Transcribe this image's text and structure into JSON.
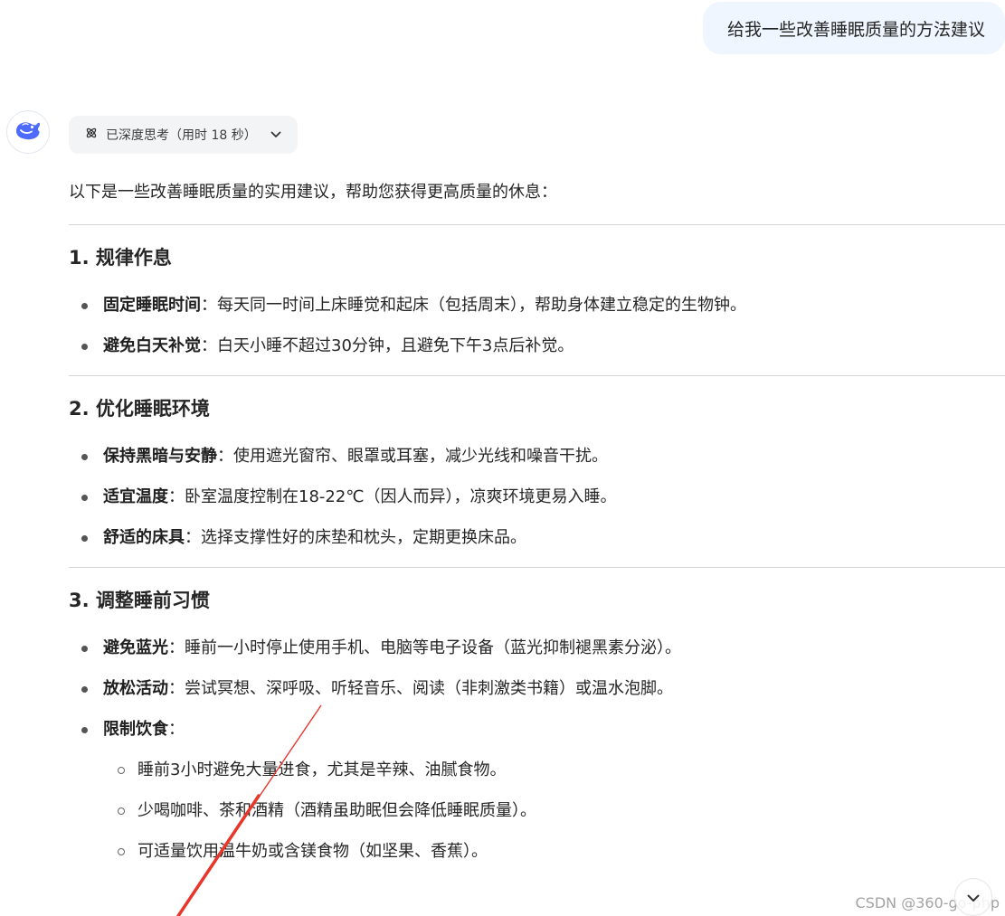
{
  "user_message": "给我一些改善睡眠质量的方法建议",
  "thinking": {
    "label": "已深度思考（用时 18 秒）"
  },
  "answer": {
    "intro": "以下是一些改善睡眠质量的实用建议，帮助您获得更高质量的休息：",
    "sections": [
      {
        "title": "1. 规律作息",
        "items": [
          {
            "bold": "固定睡眠时间",
            "text": "：每天同一时间上床睡觉和起床（包括周末），帮助身体建立稳定的生物钟。"
          },
          {
            "bold": "避免白天补觉",
            "text": "：白天小睡不超过30分钟，且避免下午3点后补觉。"
          }
        ]
      },
      {
        "title": "2. 优化睡眠环境",
        "items": [
          {
            "bold": "保持黑暗与安静",
            "text": "：使用遮光窗帘、眼罩或耳塞，减少光线和噪音干扰。"
          },
          {
            "bold": "适宜温度",
            "text": "：卧室温度控制在18-22℃（因人而异），凉爽环境更易入睡。"
          },
          {
            "bold": "舒适的床具",
            "text": "：选择支撑性好的床垫和枕头，定期更换床品。"
          }
        ]
      },
      {
        "title": "3. 调整睡前习惯",
        "items": [
          {
            "bold": "避免蓝光",
            "text": "：睡前一小时停止使用手机、电脑等电子设备（蓝光抑制褪黑素分泌）。"
          },
          {
            "bold": "放松活动",
            "text": "：尝试冥想、深呼吸、听轻音乐、阅读（非刺激类书籍）或温水泡脚。"
          },
          {
            "bold": "限制饮食",
            "text": "："
          }
        ],
        "subitems": [
          "睡前3小时避免大量进食，尤其是辛辣、油腻食物。",
          "少喝咖啡、茶和酒精（酒精虽助眠但会降低睡眠质量）。",
          "可适量饮用温牛奶或含镁食物（如坚果、香蕉）。"
        ]
      }
    ]
  },
  "watermark": "CSDN @360-go-php",
  "colors": {
    "user_bubble_bg": "#eff6ff",
    "think_pill_bg": "#f3f4f6",
    "brand_blue": "#4d6bfe",
    "annotation_red": "#e8362b"
  },
  "icons": {
    "avatar": "deepseek-whale-icon",
    "thinking": "atom-icon",
    "toggle": "chevron-down-icon",
    "scroll": "chevron-down-icon"
  }
}
